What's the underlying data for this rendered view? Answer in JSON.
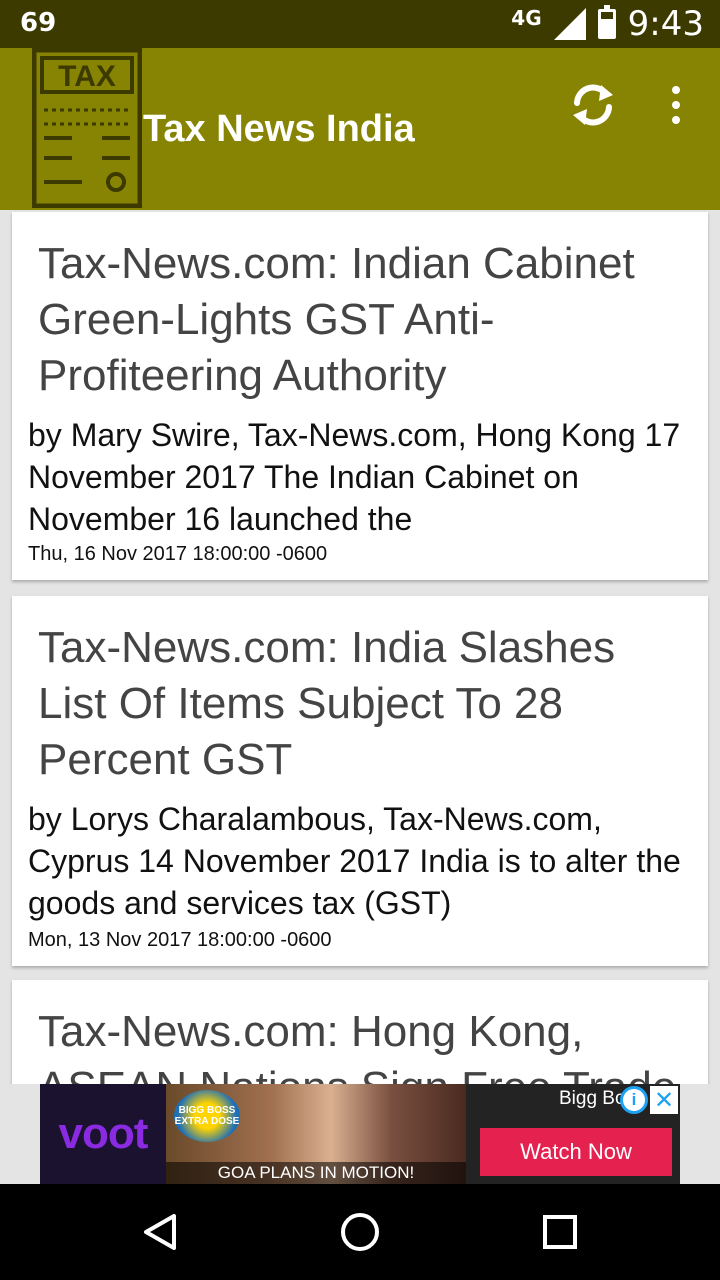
{
  "status_bar": {
    "notification_count": "69",
    "network": "4G",
    "time": "9:43"
  },
  "app_bar": {
    "logo_text": "TAX",
    "title": "Tax News India"
  },
  "articles": [
    {
      "title": "Tax-News.com: Indian Cabinet Green-Lights GST Anti-Profiteering Authority",
      "description": "by Mary Swire, Tax-News.com, Hong Kong  17 November 2017   The Indian Cabinet on November 16 launched the",
      "date": "Thu, 16 Nov 2017 18:00:00 -0600"
    },
    {
      "title": "Tax-News.com: India Slashes List Of Items Subject To 28 Percent GST",
      "description": "by Lorys Charalambous, Tax-News.com, Cyprus  14 November 2017   India is to alter the goods and services tax (GST)",
      "date": "Mon, 13 Nov 2017 18:00:00 -0600"
    },
    {
      "title": "Tax-News.com: Hong Kong, ASEAN Nations Sign Free Trade",
      "description": "",
      "date": ""
    }
  ],
  "ad": {
    "brand": "voot",
    "show_logo": "BIGG BOSS EXTRA DOSE",
    "caption": "GOA PLANS IN MOTION!",
    "advertiser": "Bigg Bo",
    "cta": "Watch Now"
  },
  "colors": {
    "status_bar": "#3d3a00",
    "app_bar": "#878404",
    "cta": "#e5224f"
  }
}
